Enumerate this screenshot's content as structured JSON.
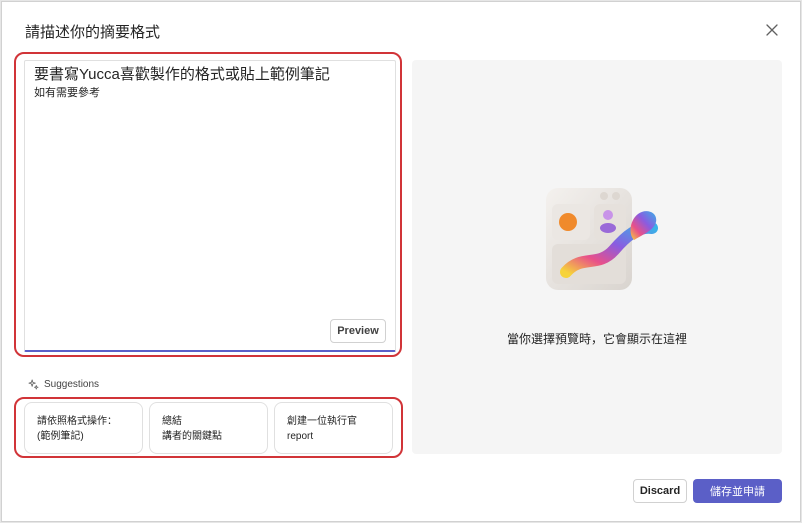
{
  "dialog": {
    "title": "請描述你的摘要格式",
    "close_icon": "close-icon"
  },
  "input": {
    "line1": "要書寫Yucca喜歡製作的格式或貼上範例筆記",
    "line2": "如有需要參考",
    "preview_label": "Preview",
    "accent_color": "#5b5fc7"
  },
  "suggestions": {
    "label": "Suggestions",
    "icon": "sparkle-icon",
    "chips": [
      {
        "line1": "請依照格式操作：",
        "line2": "(範例筆記)"
      },
      {
        "line1": "總結",
        "line2": "講者的關鍵點"
      },
      {
        "line1": "創建一位執行官",
        "line2": "report"
      }
    ]
  },
  "preview_panel": {
    "message": "當你選擇預覽時，它會顯示在這裡",
    "illustration": "layout-paintbrush-illustration"
  },
  "footer": {
    "discard_label": "Discard",
    "save_label": "儲存並申請",
    "primary_color": "#5b5fc7"
  },
  "highlight_color": "#d13438"
}
